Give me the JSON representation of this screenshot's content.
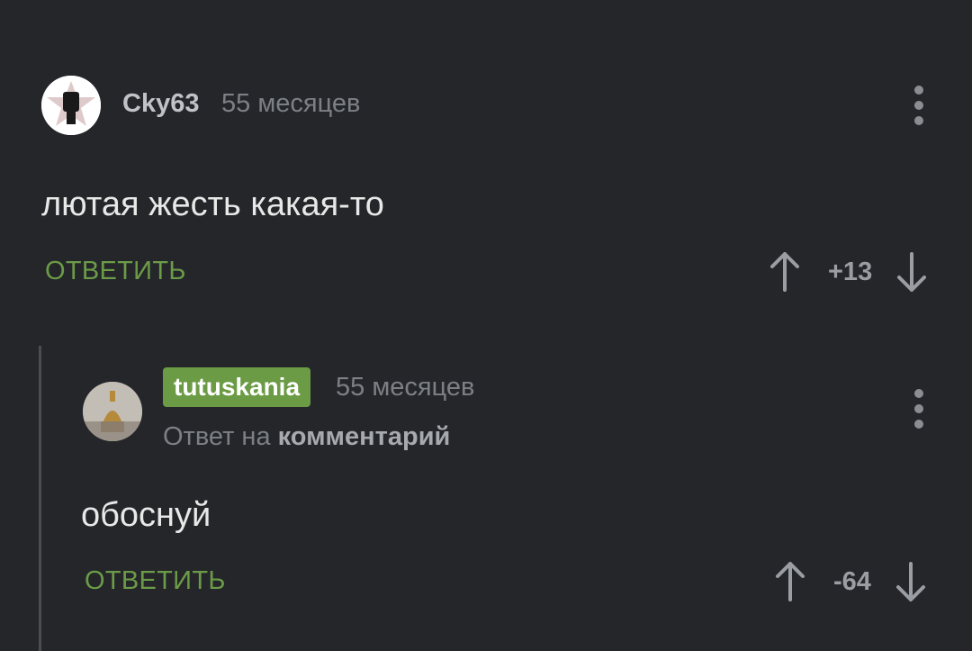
{
  "comments": [
    {
      "username": "Cky63",
      "time": "55 месяцев",
      "text": "лютая жесть какая-то",
      "reply_label": "ОТВЕТИТЬ",
      "score": "+13"
    },
    {
      "username": "tutuskania",
      "time": "55 месяцев",
      "reply_to_prefix": "Ответ на",
      "reply_to_link": "комментарий",
      "text": "обоснуй",
      "reply_label": "ОТВЕТИТЬ",
      "score": "-64"
    }
  ],
  "icons": {
    "upvote": "arrow-up-icon",
    "downvote": "arrow-down-icon",
    "menu": "more-vertical-icon"
  },
  "colors": {
    "background": "#24262a",
    "accent": "#6b9b45"
  }
}
